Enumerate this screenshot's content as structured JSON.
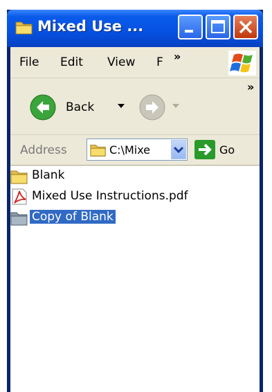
{
  "window": {
    "title": "Mixed Use ..."
  },
  "menu": {
    "items": [
      "File",
      "Edit",
      "View",
      "F"
    ],
    "overflow": "»"
  },
  "toolbar": {
    "back_label": "Back",
    "overflow": "»"
  },
  "address": {
    "label": "Address",
    "value": "C:\\Mixe",
    "go_label": "Go"
  },
  "files": [
    {
      "name": "Blank",
      "icon": "folder-icon",
      "selected": false
    },
    {
      "name": "Mixed Use Instructions.pdf",
      "icon": "pdf-icon",
      "selected": false
    },
    {
      "name": "Copy of Blank",
      "icon": "folder-icon",
      "selected": true
    }
  ],
  "colors": {
    "titlebar": "#0652e3",
    "selection": "#316ac5",
    "chrome": "#ece9d8"
  }
}
